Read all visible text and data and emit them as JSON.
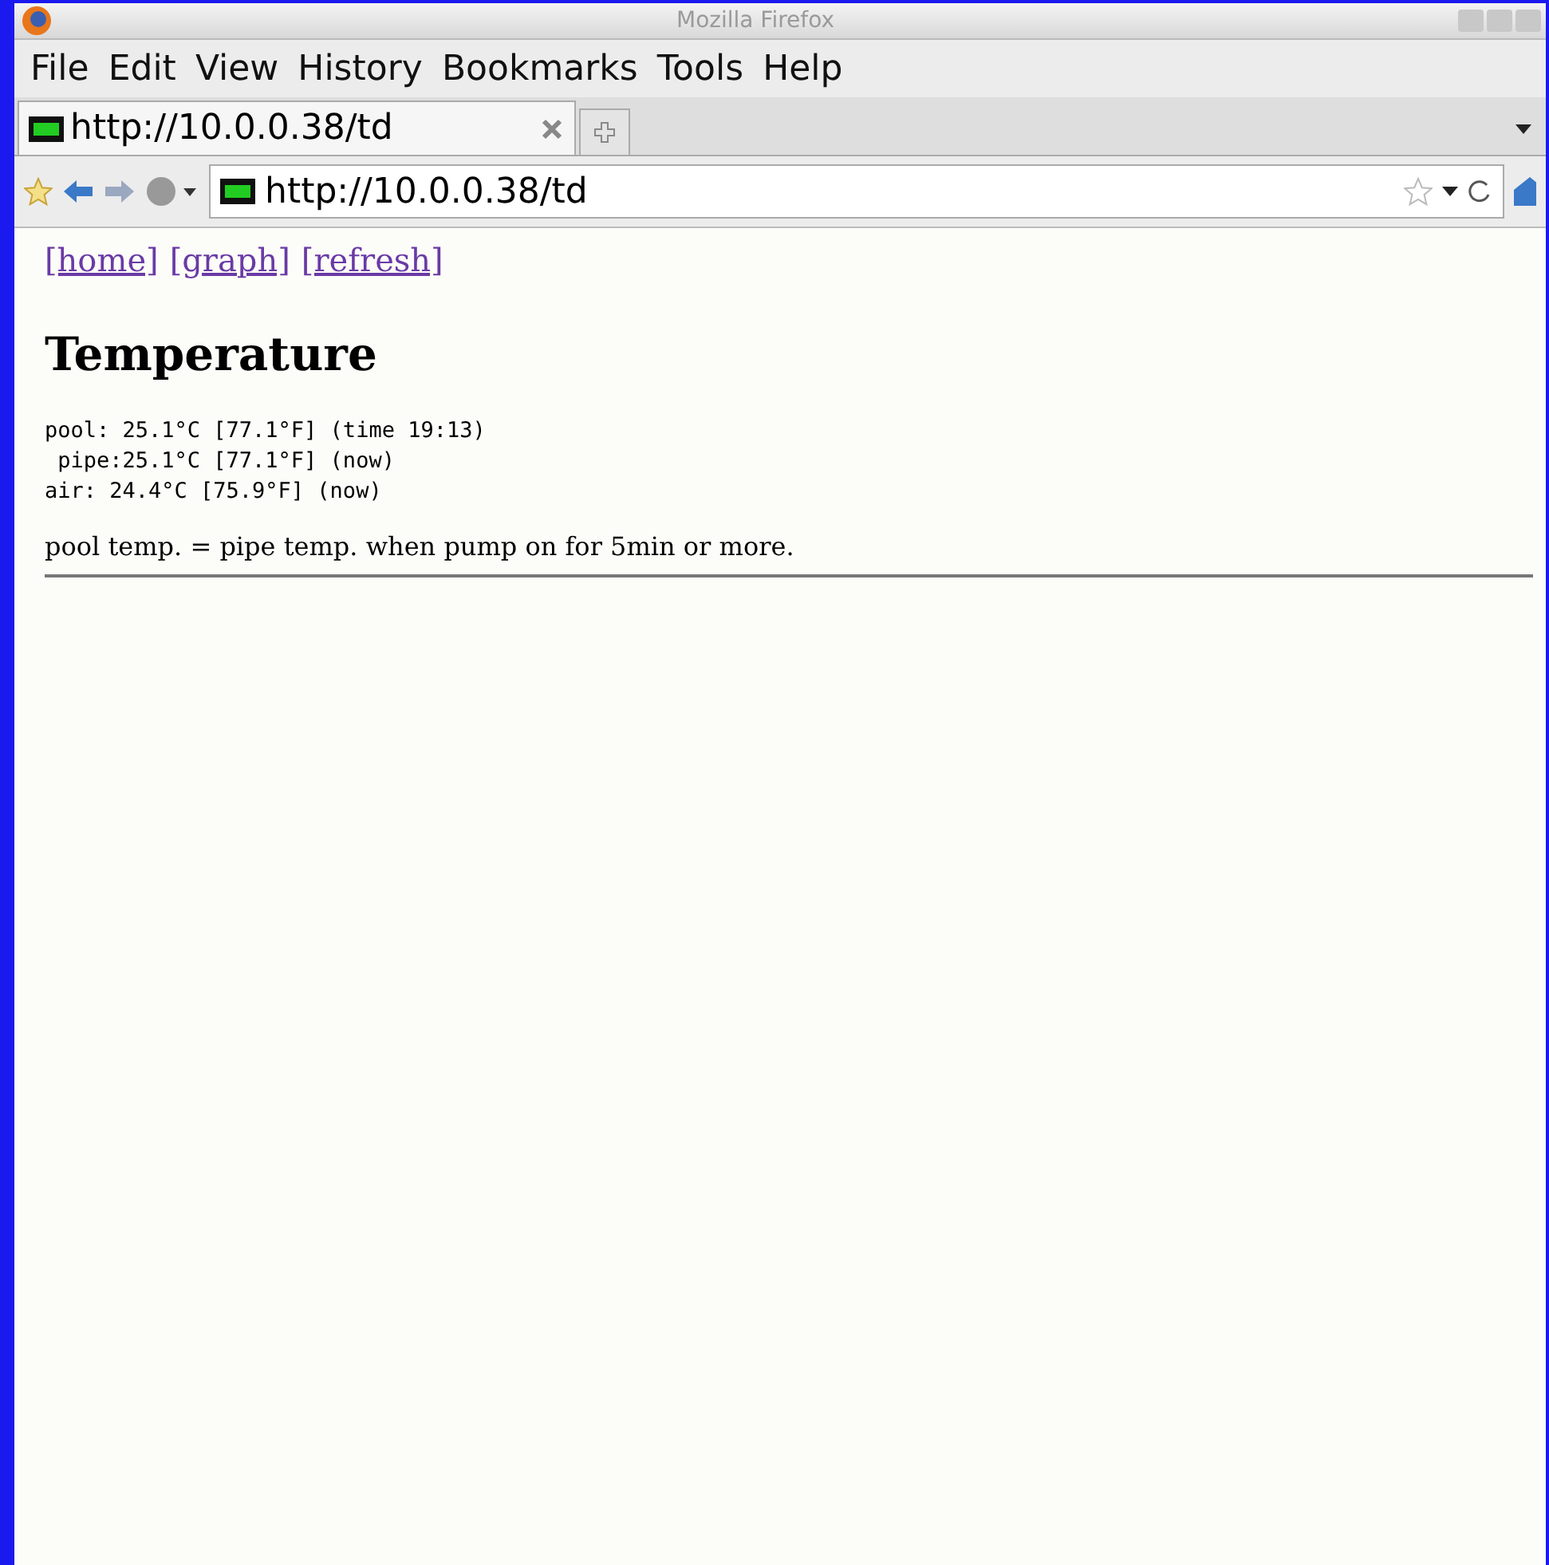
{
  "window": {
    "title": "Mozilla Firefox"
  },
  "menu": [
    "File",
    "Edit",
    "View",
    "History",
    "Bookmarks",
    "Tools",
    "Help"
  ],
  "tabs": [
    {
      "label": "http://10.0.0.38/td",
      "selected": true
    }
  ],
  "address_bar": {
    "value": "http://10.0.0.38/td"
  },
  "page": {
    "links": [
      "[home]",
      "[graph]",
      "[refresh]"
    ],
    "heading": "Temperature",
    "readings": [
      "pool: 25.1°C [77.1°F] (time 19:13)",
      " pipe:25.1°C [77.1°F] (now)",
      "air: 24.4°C [75.9°F] (now)"
    ],
    "note": "pool temp. = pipe temp. when pump on for 5min or more."
  }
}
